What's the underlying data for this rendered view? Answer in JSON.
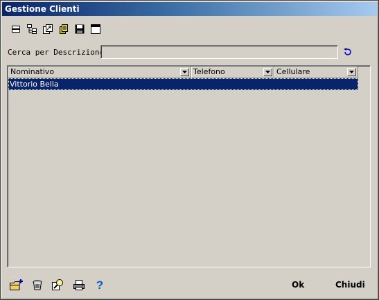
{
  "window": {
    "title": "Gestione Clienti"
  },
  "toolbar": {
    "buttons": [
      {
        "icon": "collapse-rows-icon"
      },
      {
        "icon": "tree-view-icon"
      },
      {
        "icon": "export-icon"
      },
      {
        "icon": "database-icon"
      },
      {
        "icon": "save-icon"
      },
      {
        "icon": "window-icon"
      }
    ]
  },
  "search": {
    "label": "Cerca per Descrizione:",
    "value": "",
    "go_icon": "undo-arrow-icon"
  },
  "grid": {
    "columns": [
      "Nominativo",
      "Telefono",
      "Cellulare"
    ],
    "rows": [
      {
        "nominativo": "Vittorio Bella",
        "telefono": "",
        "cellulare": ""
      }
    ],
    "selected_row": 0
  },
  "bottom": {
    "icons": [
      "new-record-icon",
      "delete-icon",
      "search-record-icon",
      "print-icon",
      "help-icon"
    ],
    "ok_label": "Ok",
    "close_label": "Chiudi"
  },
  "colors": {
    "title_start": "#0a246a",
    "title_end": "#a6caf0",
    "selection": "#0a246a",
    "face": "#d4d0c8"
  }
}
